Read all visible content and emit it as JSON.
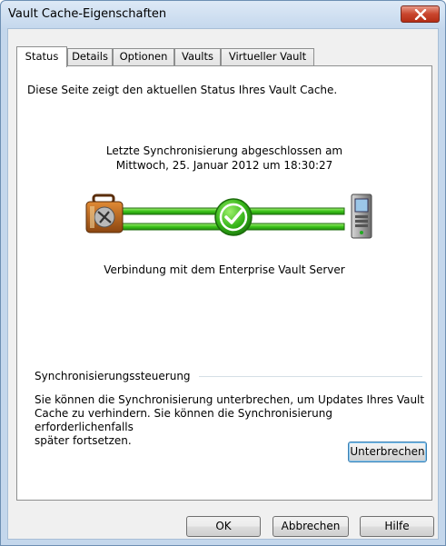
{
  "window": {
    "title": "Vault Cache-Eigenschaften"
  },
  "tabs": [
    {
      "label": "Status",
      "active": true
    },
    {
      "label": "Details",
      "active": false
    },
    {
      "label": "Optionen",
      "active": false
    },
    {
      "label": "Vaults",
      "active": false
    },
    {
      "label": "Virtueller Vault",
      "active": false
    }
  ],
  "status": {
    "intro": "Diese Seite zeigt den aktuellen Status Ihres Vault Cache.",
    "sync_line1": "Letzte Synchronisierung abgeschlossen am",
    "sync_line2": "Mittwoch, 25. Januar 2012 um 18:30:27",
    "connection": "Verbindung mit dem Enterprise Vault Server",
    "connection_state": "connected"
  },
  "sync_control": {
    "group_label": "Synchronisierungssteuerung",
    "description_line1": "Sie können die Synchronisierung unterbrechen, um Updates Ihres Vault",
    "description_line2": "Cache zu verhindern. Sie können die Synchronisierung erforderlichenfalls",
    "description_line3": "später fortsetzen.",
    "pause_button": "Unterbrechen"
  },
  "footer": {
    "ok": "OK",
    "cancel": "Abbrechen",
    "help": "Hilfe"
  },
  "icons": {
    "client": "laptop-bag-icon",
    "status": "checkmark-icon",
    "server": "server-icon"
  }
}
